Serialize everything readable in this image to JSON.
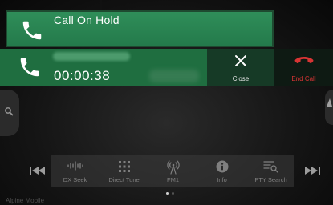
{
  "call_on_hold": {
    "label": "Call On Hold",
    "icon": "phone-icon"
  },
  "active_call": {
    "timer": "00:00:38",
    "icon": "phone-icon"
  },
  "actions": {
    "close": {
      "label": "Close",
      "icon": "close-icon"
    },
    "end_call": {
      "label": "End Call",
      "icon": "hang-up-icon",
      "color": "#d83434"
    }
  },
  "side": {
    "left_icon": "search-icon",
    "right_icon": "up-arrow-icon"
  },
  "transport": {
    "prev_icon": "skip-previous-icon",
    "next_icon": "skip-next-icon"
  },
  "function_bar": [
    {
      "label": "DX Seek",
      "icon": "waveform-icon"
    },
    {
      "label": "Direct Tune",
      "icon": "keypad-icon"
    },
    {
      "label": "FM1",
      "icon": "antenna-icon"
    },
    {
      "label": "Info",
      "icon": "info-icon"
    },
    {
      "label": "PTY Search",
      "icon": "list-search-icon"
    }
  ],
  "page_indicator": {
    "pages": 2,
    "current": 1
  },
  "brand": "Alpine Mobile",
  "colors": {
    "hold_green": "#2f8e59",
    "call_green": "#1f6e40",
    "end_call_red": "#d83434"
  }
}
